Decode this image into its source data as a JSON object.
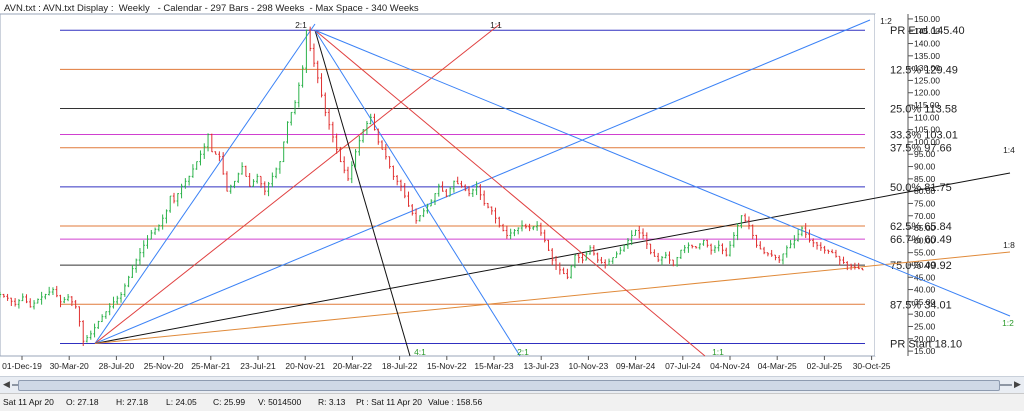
{
  "header": {
    "title": "AVN.txt : AVN.txt Display :  Weekly   - Calendar - 297 Bars - 298 Weeks  - Max Space - 340 Weeks"
  },
  "chart_data": {
    "type": "candlestick-gann",
    "y_ticks": [
      15,
      20,
      25,
      30,
      35,
      40,
      45,
      50,
      55,
      60,
      65,
      70,
      75,
      80,
      85,
      90,
      95,
      100,
      105,
      110,
      115,
      120,
      125,
      130,
      135,
      140,
      145,
      150
    ],
    "x_tick_labels": [
      "01-Dec-19",
      "30-Mar-20",
      "28-Jul-20",
      "25-Nov-20",
      "25-Mar-21",
      "23-Jul-21",
      "20-Nov-21",
      "20-Mar-22",
      "18-Jul-22",
      "15-Nov-22",
      "15-Mar-23",
      "13-Jul-23",
      "10-Nov-23",
      "09-Mar-24",
      "07-Jul-24",
      "04-Nov-24",
      "04-Mar-25",
      "02-Jul-25",
      "30-Oct-25"
    ],
    "ylim": [
      13,
      152
    ],
    "price_path": [
      [
        0,
        38
      ],
      [
        2,
        36.5
      ],
      [
        4,
        34
      ],
      [
        6,
        37
      ],
      [
        8,
        33
      ],
      [
        10,
        36
      ],
      [
        12,
        38
      ],
      [
        14,
        40
      ],
      [
        16,
        35
      ],
      [
        18,
        37
      ],
      [
        20,
        33
      ],
      [
        21,
        27
      ],
      [
        22,
        19
      ],
      [
        24,
        22
      ],
      [
        26,
        27
      ],
      [
        28,
        31
      ],
      [
        30,
        35
      ],
      [
        32,
        38
      ],
      [
        34,
        45
      ],
      [
        36,
        52
      ],
      [
        38,
        58
      ],
      [
        40,
        63
      ],
      [
        42,
        66
      ],
      [
        44,
        72
      ],
      [
        45,
        78
      ],
      [
        46,
        76
      ],
      [
        48,
        82
      ],
      [
        50,
        86
      ],
      [
        52,
        92
      ],
      [
        54,
        98
      ],
      [
        55,
        103
      ],
      [
        56,
        96
      ],
      [
        58,
        94
      ],
      [
        60,
        80
      ],
      [
        62,
        84
      ],
      [
        64,
        90
      ],
      [
        66,
        82
      ],
      [
        68,
        86
      ],
      [
        70,
        80
      ],
      [
        72,
        86
      ],
      [
        74,
        92
      ],
      [
        76,
        108
      ],
      [
        78,
        116
      ],
      [
        80,
        130
      ],
      [
        81,
        145.4
      ],
      [
        82,
        138
      ],
      [
        84,
        126
      ],
      [
        86,
        112
      ],
      [
        88,
        102
      ],
      [
        90,
        92
      ],
      [
        92,
        85
      ],
      [
        94,
        96
      ],
      [
        96,
        105
      ],
      [
        98,
        110
      ],
      [
        100,
        100
      ],
      [
        102,
        94
      ],
      [
        104,
        86
      ],
      [
        106,
        82
      ],
      [
        108,
        74
      ],
      [
        110,
        68
      ],
      [
        112,
        72
      ],
      [
        114,
        76
      ],
      [
        116,
        82
      ],
      [
        118,
        78
      ],
      [
        120,
        84
      ],
      [
        122,
        82
      ],
      [
        124,
        79
      ],
      [
        126,
        82
      ],
      [
        128,
        75
      ],
      [
        130,
        72
      ],
      [
        132,
        66
      ],
      [
        134,
        62
      ],
      [
        136,
        64
      ],
      [
        138,
        66
      ],
      [
        140,
        65
      ],
      [
        142,
        66
      ],
      [
        144,
        60
      ],
      [
        146,
        52
      ],
      [
        148,
        48
      ],
      [
        150,
        45
      ],
      [
        152,
        54
      ],
      [
        154,
        52
      ],
      [
        156,
        57
      ],
      [
        158,
        52
      ],
      [
        160,
        50
      ],
      [
        162,
        53
      ],
      [
        164,
        56
      ],
      [
        166,
        60
      ],
      [
        168,
        64
      ],
      [
        170,
        62
      ],
      [
        172,
        55
      ],
      [
        174,
        52
      ],
      [
        176,
        54
      ],
      [
        178,
        50
      ],
      [
        180,
        56
      ],
      [
        182,
        58
      ],
      [
        184,
        57
      ],
      [
        186,
        60
      ],
      [
        188,
        56
      ],
      [
        190,
        58
      ],
      [
        192,
        54
      ],
      [
        194,
        62
      ],
      [
        196,
        70
      ],
      [
        198,
        66
      ],
      [
        200,
        58
      ],
      [
        202,
        55
      ],
      [
        204,
        54
      ],
      [
        206,
        52
      ],
      [
        208,
        57
      ],
      [
        210,
        60
      ],
      [
        212,
        65
      ],
      [
        214,
        60
      ],
      [
        216,
        58
      ],
      [
        218,
        56
      ],
      [
        220,
        55
      ],
      [
        222,
        52
      ],
      [
        224,
        50
      ],
      [
        226,
        49
      ],
      [
        228,
        48
      ]
    ],
    "retracements": [
      {
        "label": "PR End 145.40",
        "value": 145.4,
        "color": "#3030c0"
      },
      {
        "label": "12.5% 129.49",
        "value": 129.49,
        "color": "#e07a3a"
      },
      {
        "label": "25.0% 113.58",
        "value": 113.58,
        "color": "#333333"
      },
      {
        "label": "33.3% 103.01",
        "value": 103.01,
        "color": "#d040d0"
      },
      {
        "label": "37.5% 97.66",
        "value": 97.66,
        "color": "#e07a3a"
      },
      {
        "label": "50.0% 81.75",
        "value": 81.75,
        "color": "#3030c0"
      },
      {
        "label": "62.5% 65.84",
        "value": 65.84,
        "color": "#e07a3a"
      },
      {
        "label": "66.7% 60.49",
        "value": 60.49,
        "color": "#d040d0"
      },
      {
        "label": "75.0% 49.92",
        "value": 49.92,
        "color": "#333333"
      },
      {
        "label": "87.5% 34.01",
        "value": 34.01,
        "color": "#e07a3a"
      },
      {
        "label": "PR Start 18.10",
        "value": 18.1,
        "color": "#3030c0"
      }
    ],
    "fan_labels": [
      "2:1",
      "1:1",
      "1:2",
      "1:4",
      "1:8",
      "4:1",
      "2:1",
      "1:1",
      "1:2"
    ]
  },
  "status_bar": {
    "date": "Sat 11 Apr 20",
    "open": "O: 27.18",
    "high": "H: 27.18",
    "low": "L: 24.05",
    "close": "C: 25.99",
    "volume": "V: 5014500",
    "range": "R: 3.13",
    "pt": "Pt : Sat 11 Apr 20",
    "value": "Value : 158.56"
  }
}
